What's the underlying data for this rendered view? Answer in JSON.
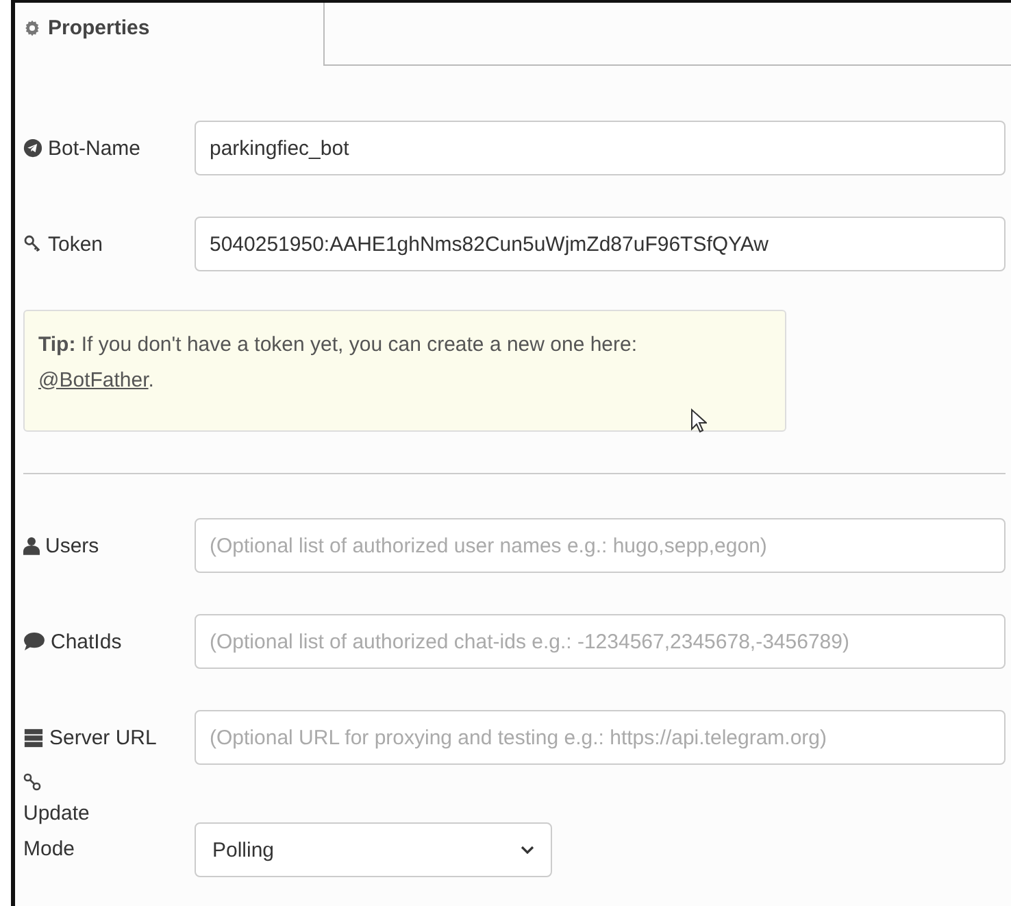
{
  "tab": {
    "label": "Properties"
  },
  "fields": [
    {
      "label": "Bot-Name",
      "value": "parkingfiec_bot"
    },
    {
      "label": "Token",
      "value": "5040251950:AAHE1ghNms82Cun5uWjmZd87uF96TSfQYAw"
    }
  ],
  "tip": {
    "text": "**Tip:** If you don't have a token yet, you can create a new one here:",
    "link": "@BotFather",
    "after": "."
  },
  "optional_fields": [
    {
      "label": "Users",
      "placeholder": "(Optional list of authorized user names e.g.: hugo,sepp,egon)"
    },
    {
      "label": "ChatIds",
      "placeholder": "(Optional list of authorized chat-ids e.g.: -1234567,2345678,-3456789)"
    },
    {
      "label": "Server URL",
      "placeholder": "(Optional URL for proxying and testing e.g.: https://api.telegram.org)"
    }
  ],
  "update_mode": {
    "label": "Update Mode",
    "value": "Polling"
  }
}
